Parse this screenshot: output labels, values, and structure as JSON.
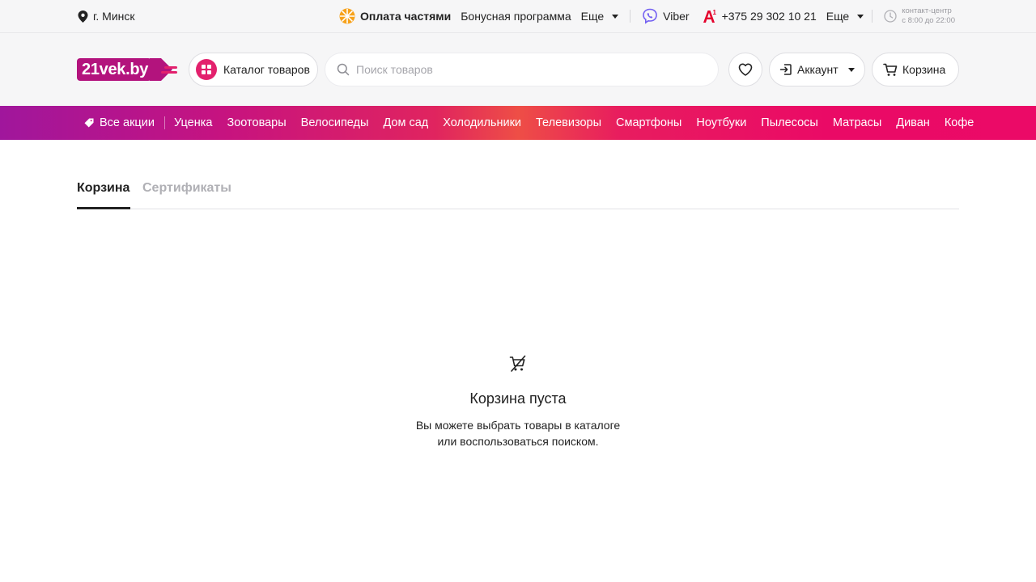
{
  "topbar": {
    "city": "г. Минск",
    "installment": "Оплата частями",
    "bonus": "Бонусная программа",
    "more1": "Еще",
    "viber": "Viber",
    "phone": "+375 29 302 10 21",
    "more2": "Еще",
    "contact_line1": "контакт-центр",
    "contact_line2": "с 8:00 до 22:00"
  },
  "header": {
    "logo_text": "21vek.by",
    "catalog_label": "Каталог товаров",
    "search_placeholder": "Поиск товаров",
    "account_label": "Аккаунт",
    "cart_label": "Корзина"
  },
  "promo_nav": {
    "all_label": "Все акции",
    "items": [
      "Уценка",
      "Зоотовары",
      "Велосипеды",
      "Дом сад",
      "Холодильники",
      "Телевизоры",
      "Смартфоны",
      "Ноутбуки",
      "Пылесосы",
      "Матрасы",
      "Диван",
      "Кофе"
    ]
  },
  "tabs": {
    "cart": "Корзина",
    "certificates": "Сертификаты"
  },
  "empty_state": {
    "title": "Корзина пуста",
    "line1": "Вы можете выбрать товары в каталоге",
    "line2": "или воспользоваться поиском."
  },
  "colors": {
    "brand": "#b3137d",
    "accent": "#e3216d",
    "installment_icon": "#f7a21b",
    "viber": "#7360f2",
    "a1": "#e4002b"
  }
}
